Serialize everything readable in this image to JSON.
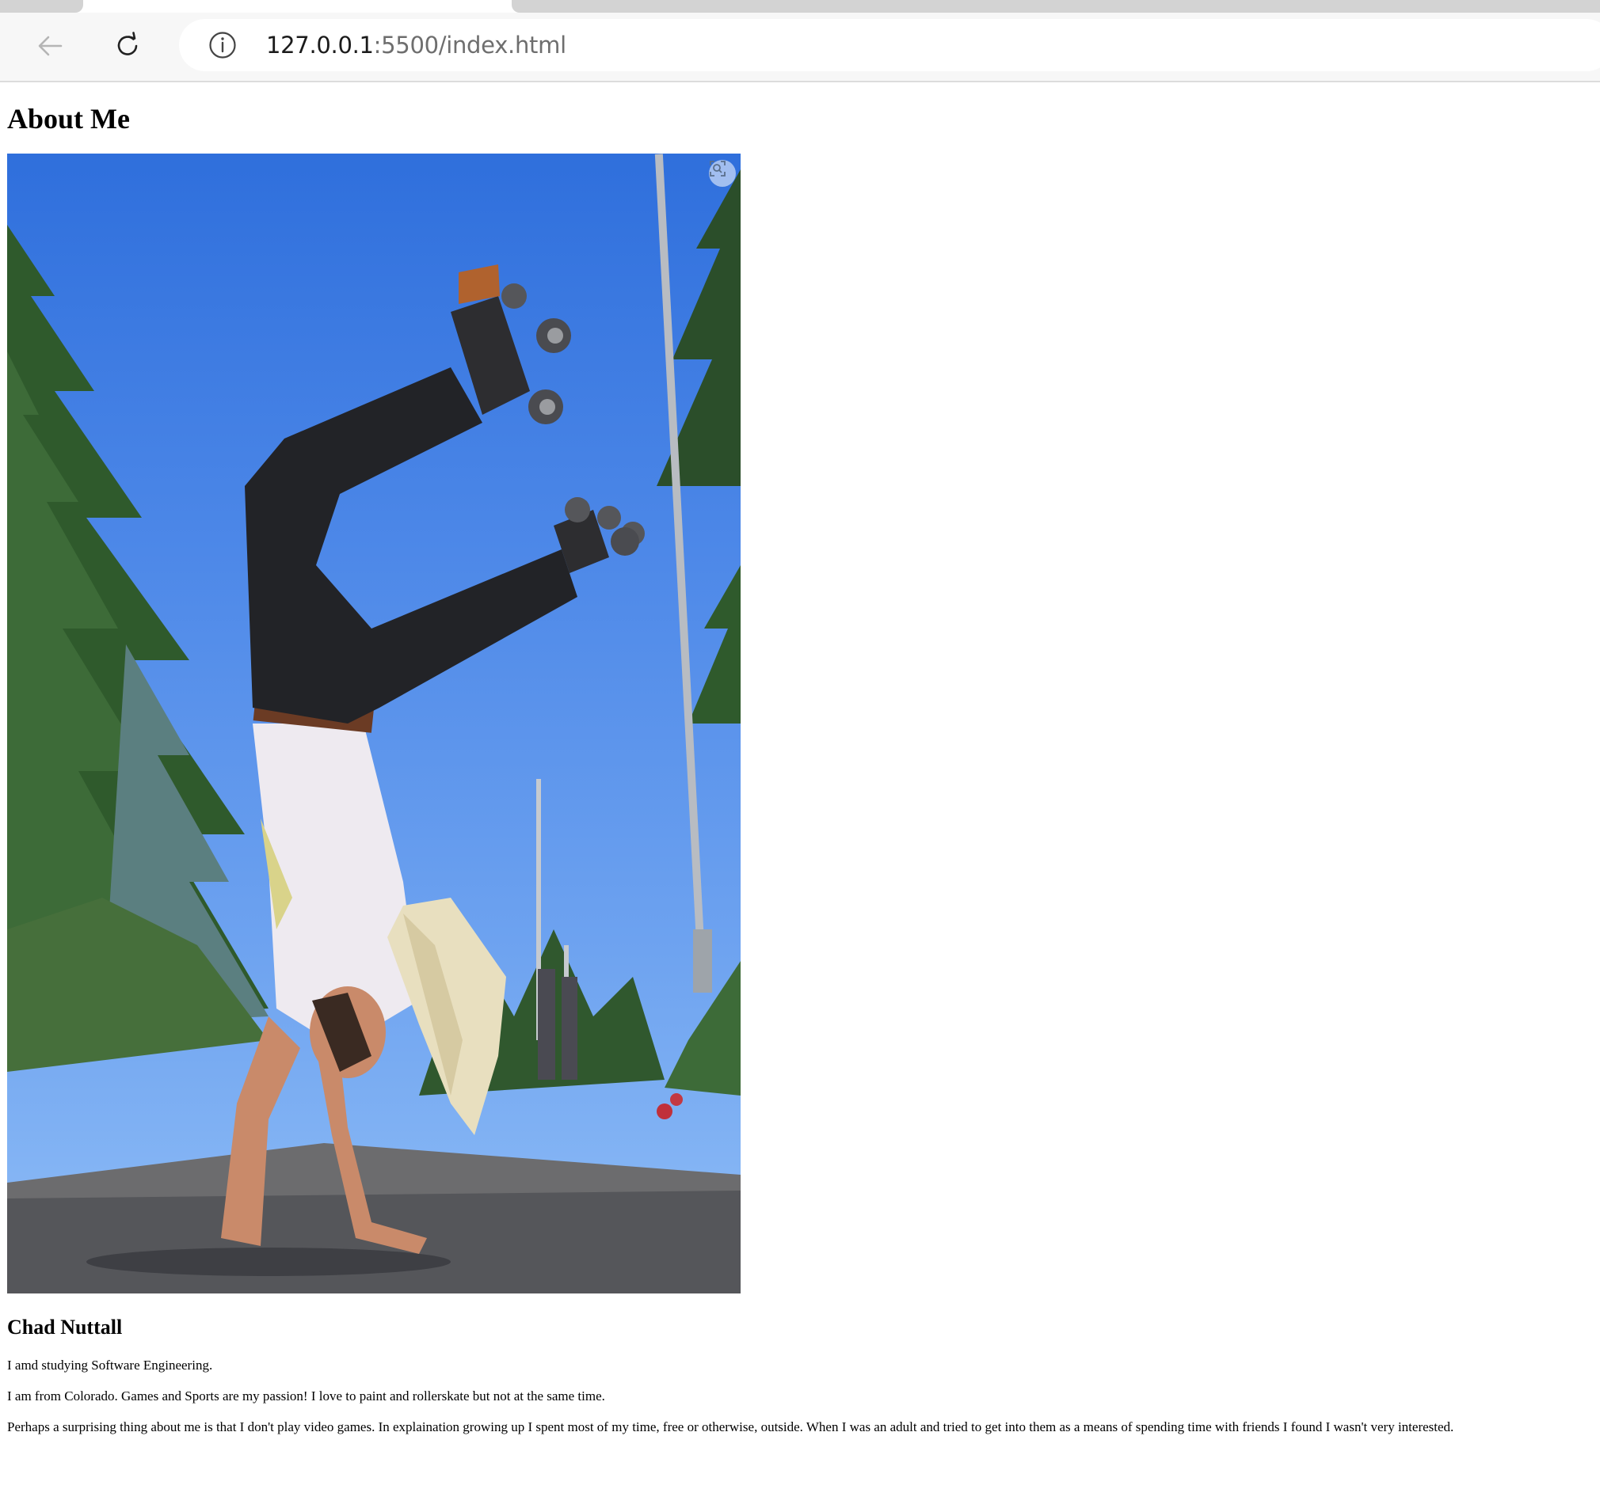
{
  "browser": {
    "url_host": "127.0.0.1",
    "url_path": ":5500/index.html",
    "icons": {
      "back": "back-arrow-icon",
      "reload": "reload-icon",
      "site_info": "info-icon"
    }
  },
  "page": {
    "heading": "About Me",
    "name": "Chad Nuttall",
    "paragraphs": [
      "I amd studying Software Engineering.",
      "I am from Colorado. Games and Sports are my passion! I love to paint and rollerskate but not at the same time.",
      "Perhaps a surprising thing about me is that I don't play video games. In explaination growing up I spent most of my time, free or otherwise, outside. When I was an adult and tried to get into them as a means of spending time with friends I found I wasn't very interested."
    ],
    "photo_overlay_icon": "visual-search-icon"
  }
}
